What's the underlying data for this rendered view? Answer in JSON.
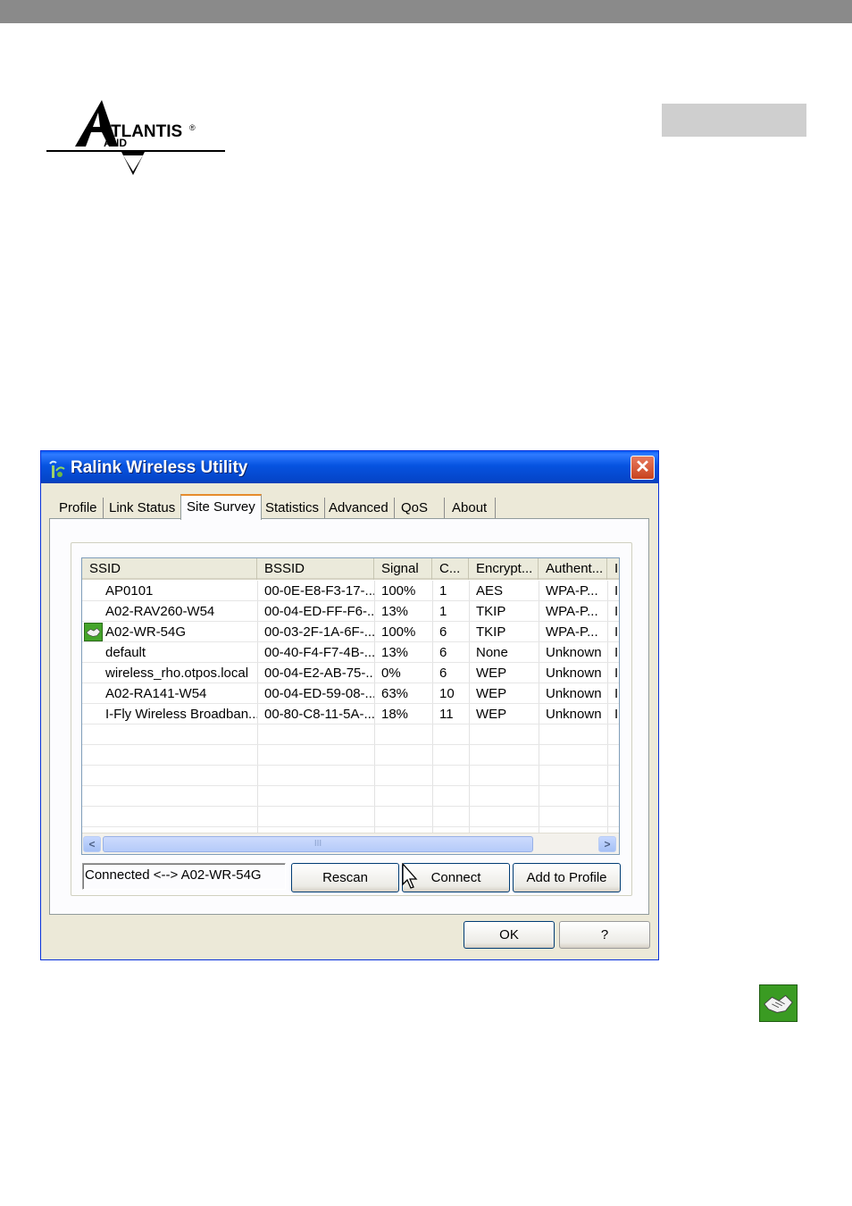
{
  "brand": {
    "logo_text": "TLANTIS",
    "logo_sub": "AND",
    "logo_mark": "A",
    "registered": "®"
  },
  "window": {
    "title": "Ralink Wireless Utility",
    "close_label": "✕"
  },
  "tabs": [
    {
      "label": "Profile"
    },
    {
      "label": "Link Status"
    },
    {
      "label": "Site Survey",
      "active": true
    },
    {
      "label": "Statistics"
    },
    {
      "label": "Advanced"
    },
    {
      "label": "QoS"
    },
    {
      "label": "About"
    }
  ],
  "table": {
    "columns": [
      "SSID",
      "BSSID",
      "Signal",
      "C...",
      "Encrypt...",
      "Authent...",
      "I"
    ],
    "rows": [
      {
        "ssid": "AP0101",
        "bssid": "00-0E-E8-F3-17-...",
        "signal": "100%",
        "channel": "1",
        "encryption": "AES",
        "auth": "WPA-P...",
        "extra": "I",
        "connected": false
      },
      {
        "ssid": "A02-RAV260-W54",
        "bssid": "00-04-ED-FF-F6-...",
        "signal": "13%",
        "channel": "1",
        "encryption": "TKIP",
        "auth": "WPA-P...",
        "extra": "I",
        "connected": false
      },
      {
        "ssid": "A02-WR-54G",
        "bssid": "00-03-2F-1A-6F-...",
        "signal": "100%",
        "channel": "6",
        "encryption": "TKIP",
        "auth": "WPA-P...",
        "extra": "I",
        "connected": true
      },
      {
        "ssid": "default",
        "bssid": "00-40-F4-F7-4B-...",
        "signal": "13%",
        "channel": "6",
        "encryption": "None",
        "auth": "Unknown",
        "extra": "I",
        "connected": false
      },
      {
        "ssid": "wireless_rho.otpos.local",
        "bssid": "00-04-E2-AB-75-...",
        "signal": "0%",
        "channel": "6",
        "encryption": "WEP",
        "auth": "Unknown",
        "extra": "I",
        "connected": false
      },
      {
        "ssid": "A02-RA141-W54",
        "bssid": "00-04-ED-59-08-...",
        "signal": "63%",
        "channel": "10",
        "encryption": "WEP",
        "auth": "Unknown",
        "extra": "I",
        "connected": false
      },
      {
        "ssid": "I-Fly Wireless Broadban...",
        "bssid": "00-80-C8-11-5A-...",
        "signal": "18%",
        "channel": "11",
        "encryption": "WEP",
        "auth": "Unknown",
        "extra": "I",
        "connected": false
      }
    ],
    "scroll_left": "<",
    "scroll_right": ">",
    "scroll_grip": "III"
  },
  "status_text": "Connected <--> A02-WR-54G",
  "buttons": {
    "rescan": "Rescan",
    "connect": "Connect",
    "add_to_profile": "Add to Profile",
    "ok": "OK",
    "help": "?"
  }
}
